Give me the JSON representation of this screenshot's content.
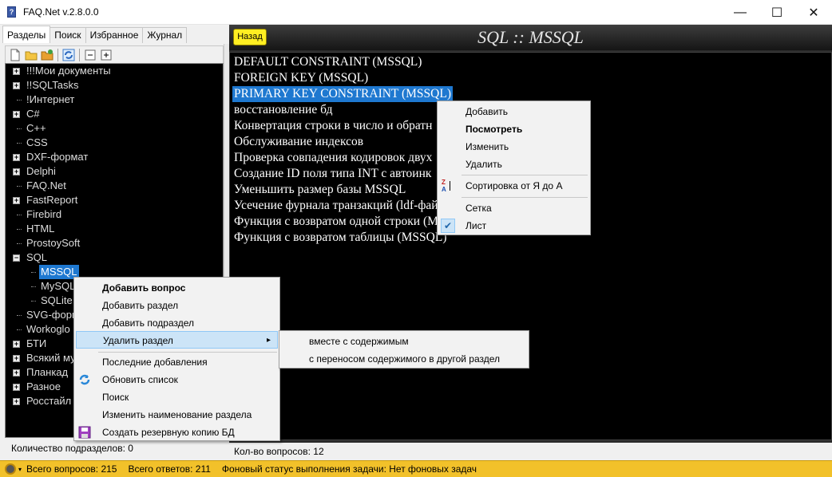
{
  "window": {
    "title": "FAQ.Net v.2.8.0.0",
    "min_glyph": "—",
    "max_glyph": "☐",
    "close_glyph": "✕"
  },
  "left": {
    "tabs": [
      "Разделы",
      "Поиск",
      "Избранное",
      "Журнал"
    ],
    "toolbar_icons": [
      "new-document-icon",
      "open-folder-icon",
      "add-folder-icon",
      "refresh-icon",
      "collapse-icon",
      "expand-icon"
    ],
    "tree": [
      {
        "label": "!!!Мои документы",
        "expander": "+",
        "level": 0
      },
      {
        "label": "!!SQLTasks",
        "expander": "+",
        "level": 0
      },
      {
        "label": "!Интернет",
        "expander": "",
        "level": 0
      },
      {
        "label": "C#",
        "expander": "+",
        "level": 0
      },
      {
        "label": "C++",
        "expander": "",
        "level": 0
      },
      {
        "label": "CSS",
        "expander": "",
        "level": 0
      },
      {
        "label": "DXF-формат",
        "expander": "+",
        "level": 0
      },
      {
        "label": "Delphi",
        "expander": "+",
        "level": 0
      },
      {
        "label": "FAQ.Net",
        "expander": "",
        "level": 0
      },
      {
        "label": "FastReport",
        "expander": "+",
        "level": 0
      },
      {
        "label": "Firebird",
        "expander": "",
        "level": 0
      },
      {
        "label": "HTML",
        "expander": "",
        "level": 0
      },
      {
        "label": "ProstoySoft",
        "expander": "",
        "level": 0
      },
      {
        "label": "SQL",
        "expander": "−",
        "level": 0
      },
      {
        "label": "MSSQL",
        "expander": "",
        "level": 1,
        "selected": true
      },
      {
        "label": "MySQL",
        "expander": "",
        "level": 1
      },
      {
        "label": "SQLite",
        "expander": "",
        "level": 1
      },
      {
        "label": "SVG-формат",
        "expander": "",
        "level": 0
      },
      {
        "label": "Workoglo",
        "expander": "",
        "level": 0
      },
      {
        "label": "БТИ",
        "expander": "+",
        "level": 0
      },
      {
        "label": "Всякий му",
        "expander": "+",
        "level": 0
      },
      {
        "label": "Планкад",
        "expander": "+",
        "level": 0
      },
      {
        "label": "Разное",
        "expander": "+",
        "level": 0
      },
      {
        "label": "Росстайл",
        "expander": "+",
        "level": 0
      }
    ],
    "status_label": "Количество подразделов:",
    "status_value": "0"
  },
  "right": {
    "back_label": "Назад",
    "header_title": "SQL :: MSSQL",
    "questions": [
      {
        "label": "DEFAULT CONSTRAINT (MSSQL)"
      },
      {
        "label": "FOREIGN KEY (MSSQL)"
      },
      {
        "label": "PRIMARY KEY CONSTRAINT (MSSQL)",
        "selected": true
      },
      {
        "label": "восстановление бд"
      },
      {
        "label": "Конвертация строки в число и обратн"
      },
      {
        "label": "Обслуживание индексов"
      },
      {
        "label": "Проверка совпадения кодировок двух"
      },
      {
        "label": "Создание ID поля типа INT с автоинк"
      },
      {
        "label": "Уменьшить размер базы MSSQL"
      },
      {
        "label": "Усечение фурнала транзакций (ldf-фай"
      },
      {
        "label": "Функция с возвратом одной строки (M"
      },
      {
        "label": "Функция с возвратом таблицы (MSSQL)"
      }
    ],
    "status_label": "Кол-во вопросов:",
    "status_value": "12"
  },
  "question_menu": {
    "add": "Добавить",
    "view": "Посмотреть",
    "edit": "Изменить",
    "delete": "Удалить",
    "sort": "Сортировка от Я до А",
    "sort_icon_top": "Z",
    "sort_icon_bottom": "A",
    "grid": "Сетка",
    "list": "Лист",
    "list_checked": true,
    "check_glyph": "✔"
  },
  "section_menu": {
    "add_question": "Добавить вопрос",
    "add_section": "Добавить раздел",
    "add_subsection": "Добавить подраздел",
    "delete_section": "Удалить раздел",
    "submenu_arrow": "▸",
    "recent": "Последние добавления",
    "refresh": "Обновить список",
    "search": "Поиск",
    "rename": "Изменить наименование раздела",
    "backup": "Создать резервную копию БД"
  },
  "delete_submenu": {
    "with_content": "вместе с содержимым",
    "move_content": "с переносом содержимого в другой раздел"
  },
  "statusbar": {
    "drop_glyph": "▾",
    "questions_label": "Всего вопросов:",
    "questions_value": "215",
    "answers_label": "Всего ответов:",
    "answers_value": "211",
    "bg_label": "Фоновый статус выполнения задачи:",
    "bg_value": "Нет фоновых задач"
  }
}
